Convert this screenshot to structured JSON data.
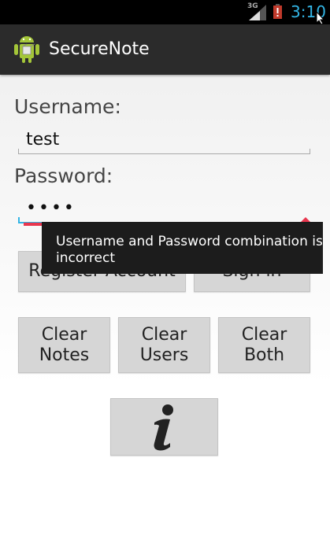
{
  "status_bar": {
    "network": "3G",
    "time": "3:10",
    "icons": [
      "signal-icon",
      "battery-alert-icon"
    ]
  },
  "action_bar": {
    "title": "SecureNote",
    "icon": "android-icon"
  },
  "form": {
    "username_label": "Username:",
    "username_value": "test",
    "password_label": "Password:",
    "password_value": "••••"
  },
  "buttons": {
    "register": "Register Account",
    "sign_in": "Sign in",
    "clear_notes": [
      "Clear",
      "Notes"
    ],
    "clear_users": [
      "Clear",
      "Users"
    ],
    "clear_both": [
      "Clear",
      "Both"
    ],
    "info_icon": "info-icon"
  },
  "error": {
    "message": "Username and Password combination is incorrect"
  },
  "colors": {
    "accent": "#33b5e5",
    "error": "#e8364e",
    "actionbar": "#2b2b2b",
    "button": "#d6d6d6"
  }
}
